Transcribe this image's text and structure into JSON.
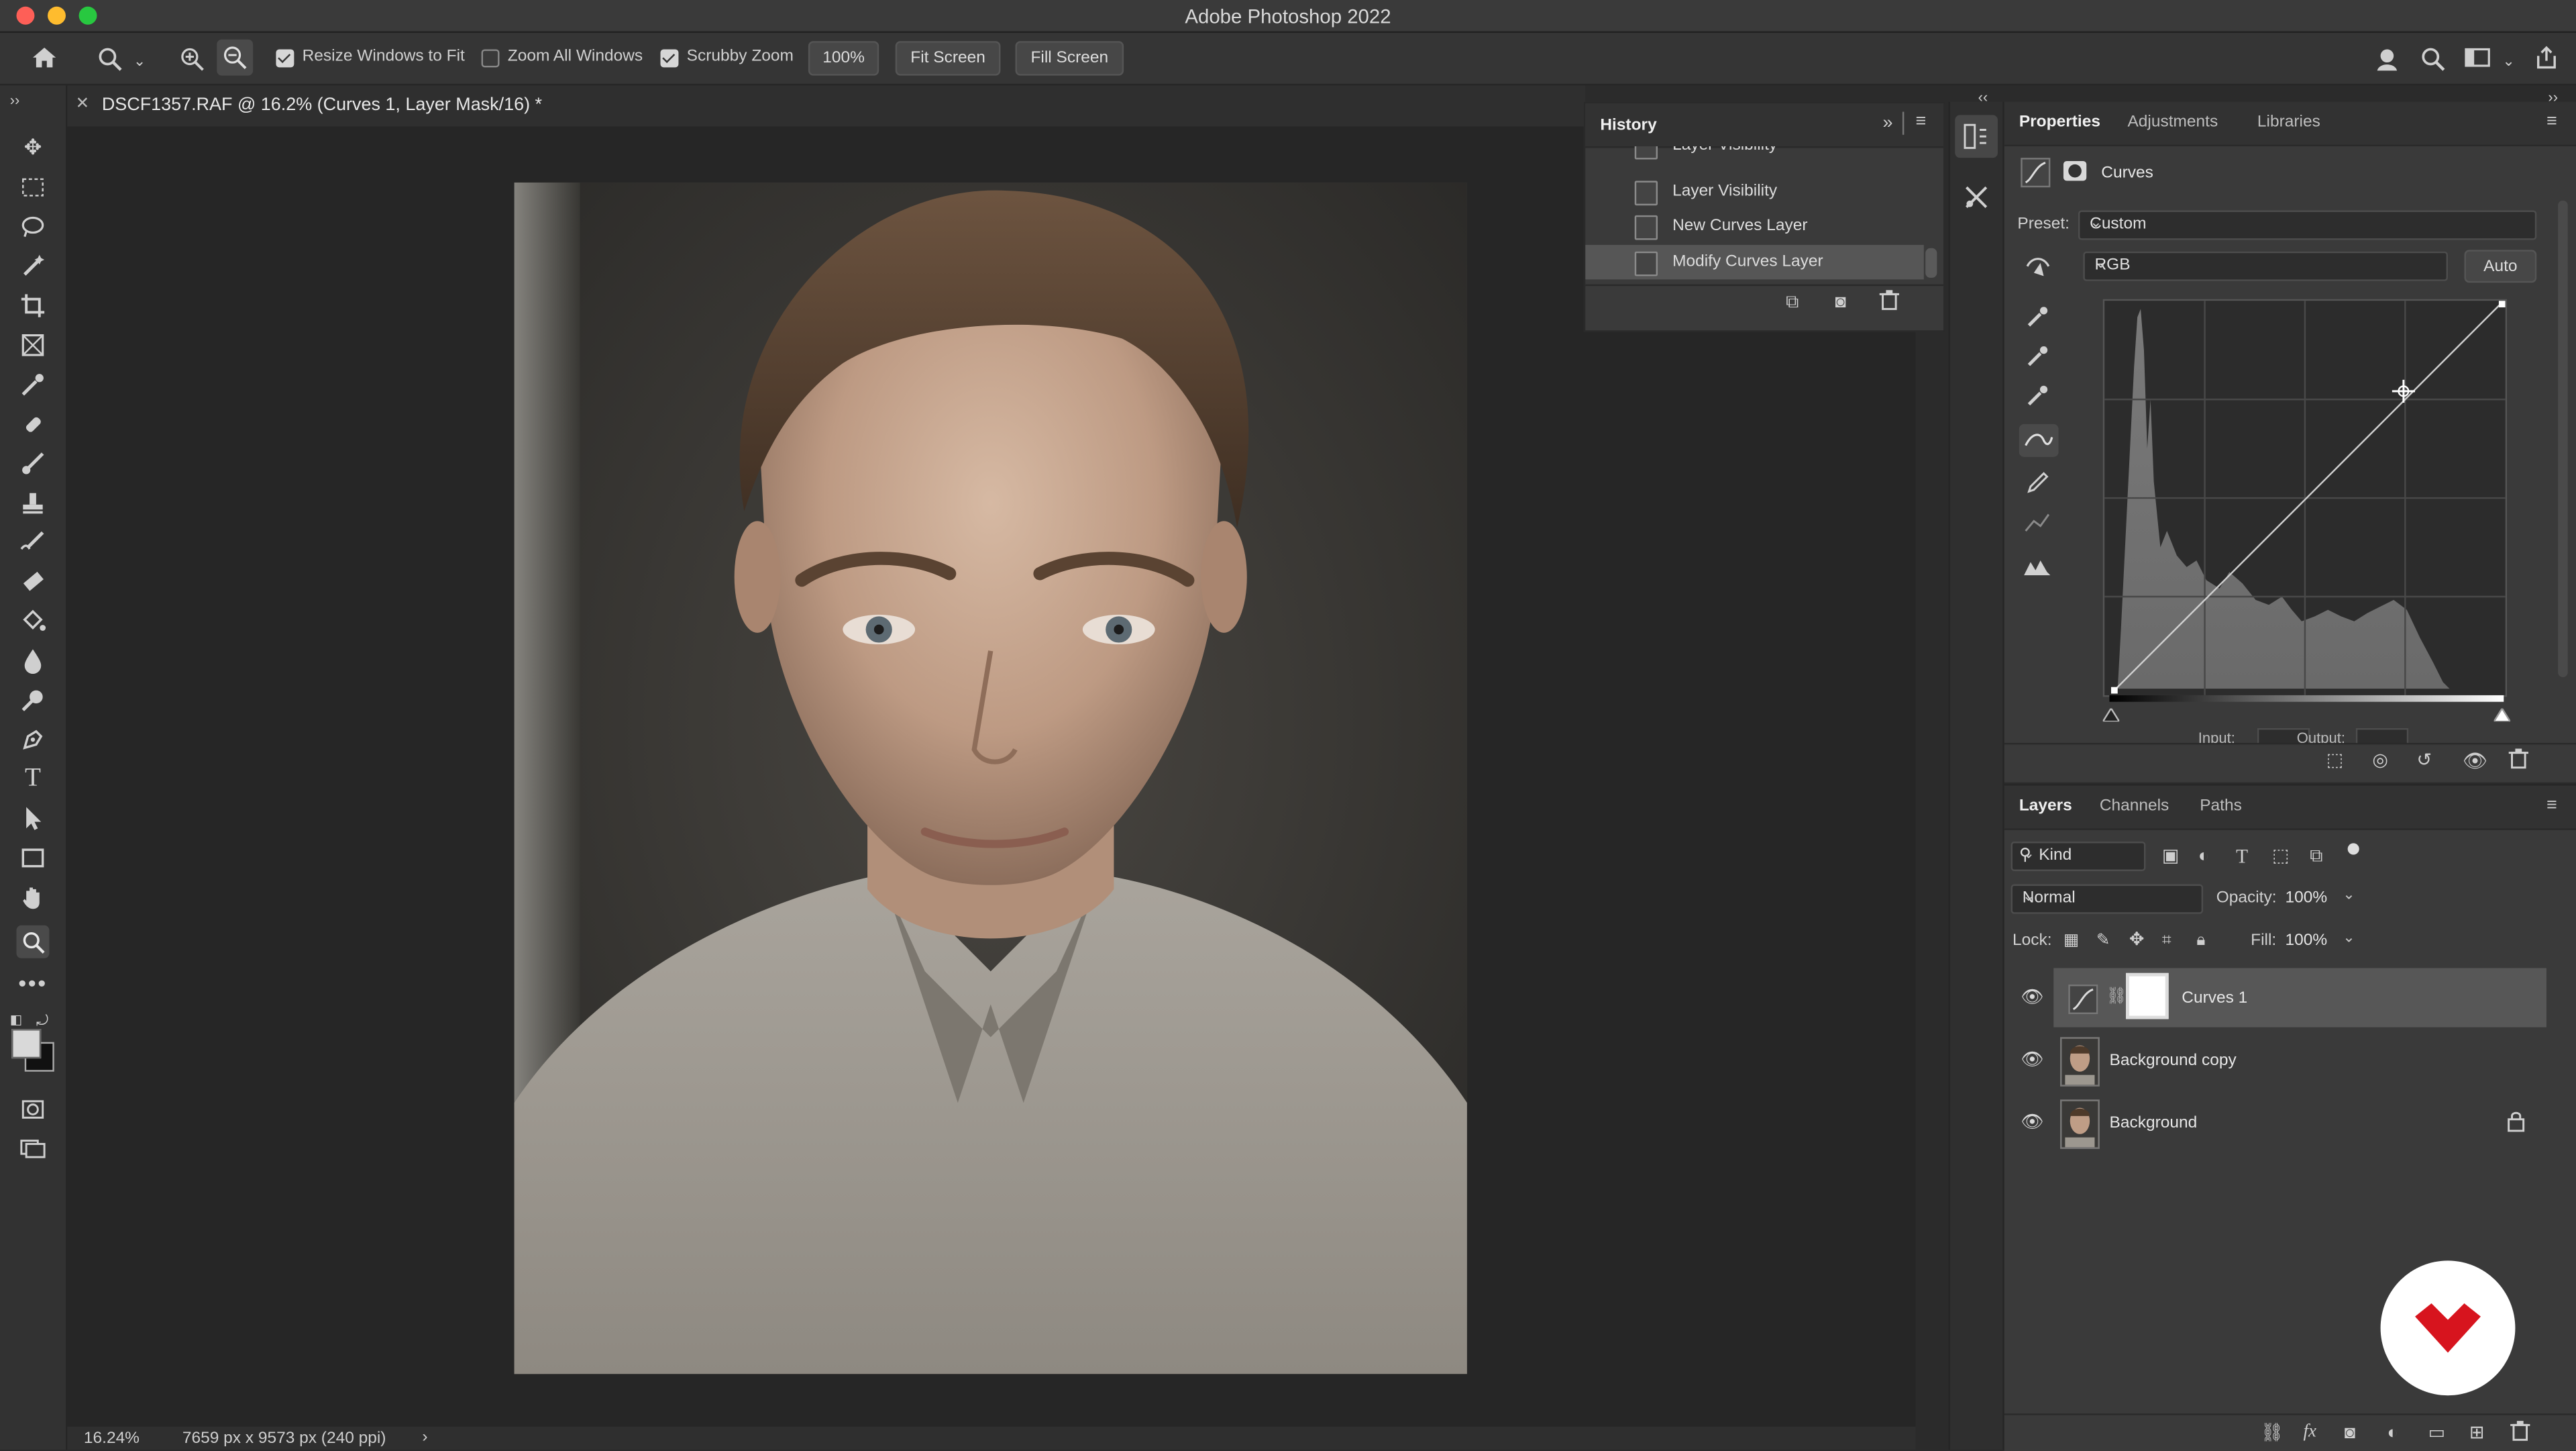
{
  "window": {
    "title": "Adobe Photoshop 2022"
  },
  "options_bar": {
    "resize_windows": "Resize Windows to Fit",
    "zoom_all": "Zoom All Windows",
    "scrubby_zoom": "Scrubby Zoom",
    "zoom_value": "100%",
    "fit_screen": "Fit Screen",
    "fill_screen": "Fill Screen",
    "resize_checked": true,
    "zoom_all_checked": false,
    "scrubby_checked": true
  },
  "document": {
    "tab_title": "DSCF1357.RAF @ 16.2% (Curves 1, Layer Mask/16) *",
    "zoom_status": "16.24%",
    "dimensions": "7659 px x 9573 px (240 ppi)"
  },
  "history": {
    "title": "History",
    "items": [
      {
        "label": "Layer Visibility"
      },
      {
        "label": "Layer Visibility"
      },
      {
        "label": "New Curves Layer"
      },
      {
        "label": "Modify Curves Layer"
      }
    ]
  },
  "properties": {
    "tabs": [
      "Properties",
      "Adjustments",
      "Libraries"
    ],
    "panel_name": "Curves",
    "preset_label": "Preset:",
    "preset_value": "Custom",
    "channel_value": "RGB",
    "auto_label": "Auto",
    "input_label": "Input:",
    "output_label": "Output:"
  },
  "layers_panel": {
    "tabs": [
      "Layers",
      "Channels",
      "Paths"
    ],
    "kind_label": "Kind",
    "blend_mode": "Normal",
    "opacity_label": "Opacity:",
    "opacity_value": "100%",
    "lock_label": "Lock:",
    "fill_label": "Fill:",
    "fill_value": "100%",
    "layers": [
      {
        "name": "Curves 1",
        "selected": true
      },
      {
        "name": "Background copy",
        "selected": false
      },
      {
        "name": "Background",
        "selected": false,
        "locked": true
      }
    ]
  },
  "colors": {
    "accent_logo": "#d7141e"
  }
}
